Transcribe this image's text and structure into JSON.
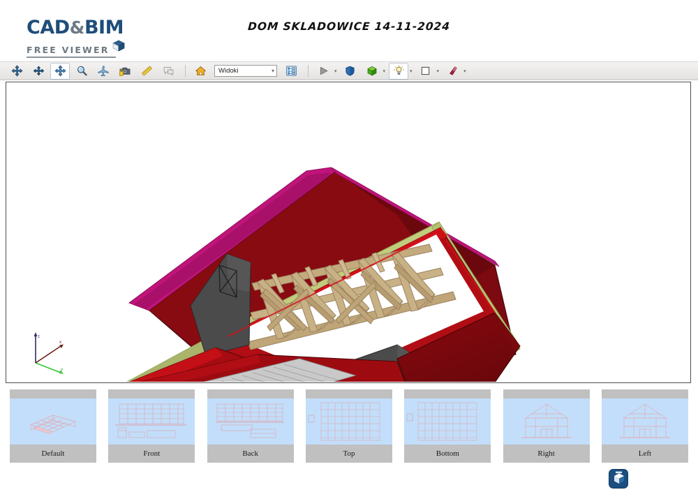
{
  "app": {
    "logo_main_left": "CAD",
    "logo_amp": "&",
    "logo_main_right": "BIM",
    "logo_sub": "FREE VIEWER",
    "logo_cube_icon": "cube-icon",
    "bottom_logo_icon": "cadbim-cube-logo-icon"
  },
  "header": {
    "document_title": "DOM SKLADOWICE 14-11-2024"
  },
  "toolbar": {
    "buttons": [
      {
        "name": "pan-tool",
        "icon": "four-way-arrow-icon",
        "label": "Pan",
        "active": false
      },
      {
        "name": "rotate-tool",
        "icon": "four-way-arrow-icon",
        "label": "Rotate",
        "active": false
      },
      {
        "name": "move-tool",
        "icon": "four-way-arrow-icon",
        "label": "Move",
        "active": true
      },
      {
        "name": "zoom-tool",
        "icon": "magnifier-icon",
        "label": "Zoom",
        "active": false
      },
      {
        "name": "fly-tool",
        "icon": "airplane-icon",
        "label": "Fly",
        "active": false
      },
      {
        "name": "camera-tool",
        "icon": "camera-icon",
        "label": "Camera",
        "active": false
      },
      {
        "name": "measure-tool",
        "icon": "ruler-icon",
        "label": "Measure",
        "active": false
      },
      {
        "name": "comment-tool",
        "icon": "speech-bubble-icon",
        "label": "Comment",
        "active": false
      }
    ],
    "home_button": {
      "name": "home-view-button",
      "icon": "home-icon",
      "label": "Home"
    },
    "views_combo": {
      "value": "Widoki",
      "chevron": "chevron-down-icon"
    },
    "tree_button": {
      "name": "model-tree-button",
      "icon": "tree-structure-icon",
      "label": "Model tree"
    },
    "right_buttons": [
      {
        "name": "animation-play-button",
        "icon": "play-triangle-icon",
        "label": "Play",
        "caret": true
      },
      {
        "name": "render-style-button",
        "icon": "blue-shield-icon",
        "label": "Render style",
        "caret": false
      },
      {
        "name": "display-mode-button",
        "icon": "green-cube-icon",
        "label": "Display mode",
        "caret": true
      },
      {
        "name": "lighting-button",
        "icon": "lamp-light-icon",
        "label": "Lighting",
        "caret": true,
        "active": true
      },
      {
        "name": "background-color-button",
        "icon": "white-square-icon",
        "label": "Background",
        "caret": true
      },
      {
        "name": "section-tool-button",
        "icon": "red-wedge-icon",
        "label": "Section",
        "caret": true
      }
    ]
  },
  "viewport": {
    "name": "model-3d-viewport",
    "background": "#ffffff",
    "axis_gizmo": {
      "name": "axis-orientation-gizmo",
      "x_axis_color": "#6b2318",
      "y_axis_color": "#32c832",
      "z_axis_color": "#2b2b6b",
      "x_label": "x",
      "y_label": "y",
      "z_label": "z"
    },
    "model": {
      "description": "Isometric 3D building model - house roof structure with wooden trusses",
      "colors": {
        "wall_red": "#b10d14",
        "wall_red_dark": "#8c0a10",
        "wall_red_deep": "#6e0a0e",
        "trim_magenta": "#c0147a",
        "beam_olive": "#c2cc7d",
        "beam_olive_dark": "#a8b268",
        "truss_tan": "#c9b186",
        "truss_tan_dark": "#a8906a",
        "panel_gray": "#4b4b4b",
        "stairs_gray": "#c9c9c9",
        "outline": "#3a3a3a"
      }
    }
  },
  "thumbnails": [
    {
      "label": "Default",
      "name": "view-thumb-default",
      "preview": "iso"
    },
    {
      "label": "Front",
      "name": "view-thumb-front",
      "preview": "front"
    },
    {
      "label": "Back",
      "name": "view-thumb-back",
      "preview": "back"
    },
    {
      "label": "Top",
      "name": "view-thumb-top",
      "preview": "plan"
    },
    {
      "label": "Bottom",
      "name": "view-thumb-bottom",
      "preview": "plan"
    },
    {
      "label": "Right",
      "name": "view-thumb-right",
      "preview": "gable"
    },
    {
      "label": "Left",
      "name": "view-thumb-left",
      "preview": "gable"
    }
  ],
  "colors": {
    "toolbar_bg": "#ececea",
    "thumb_bg": "#c0c0c0",
    "thumb_view_bg": "#c2defa",
    "accent_blue": "#1F4E79"
  }
}
